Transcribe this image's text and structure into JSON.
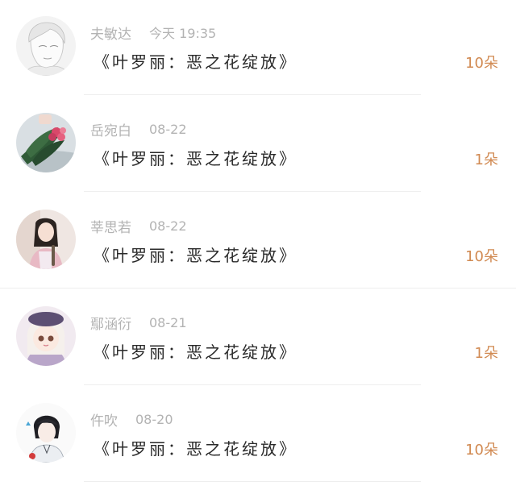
{
  "records": [
    {
      "avatar": "sketch-portrait-avatar",
      "name": "夫敏达",
      "time": "今天 19:35",
      "book": "《叶罗丽：恶之花绽放》",
      "count": "10朵"
    },
    {
      "avatar": "flower-bouquet-avatar",
      "name": "岳宛白",
      "time": "08-22",
      "book": "《叶罗丽：恶之花绽放》",
      "count": "1朵"
    },
    {
      "avatar": "girl-photo-avatar",
      "name": "莘思若",
      "time": "08-22",
      "book": "《叶罗丽：恶之花绽放》",
      "count": "10朵"
    },
    {
      "avatar": "beret-girl-avatar",
      "name": "鄢涵衍",
      "time": "08-21",
      "book": "《叶罗丽：恶之花绽放》",
      "count": "1朵"
    },
    {
      "avatar": "anime-boy-avatar",
      "name": "仵吹",
      "time": "08-20",
      "book": "《叶罗丽：恶之花绽放》",
      "count": "10朵"
    }
  ],
  "colors": {
    "count": "#d18a52",
    "meta": "#b3b3b3",
    "title": "#2a2a2a"
  }
}
